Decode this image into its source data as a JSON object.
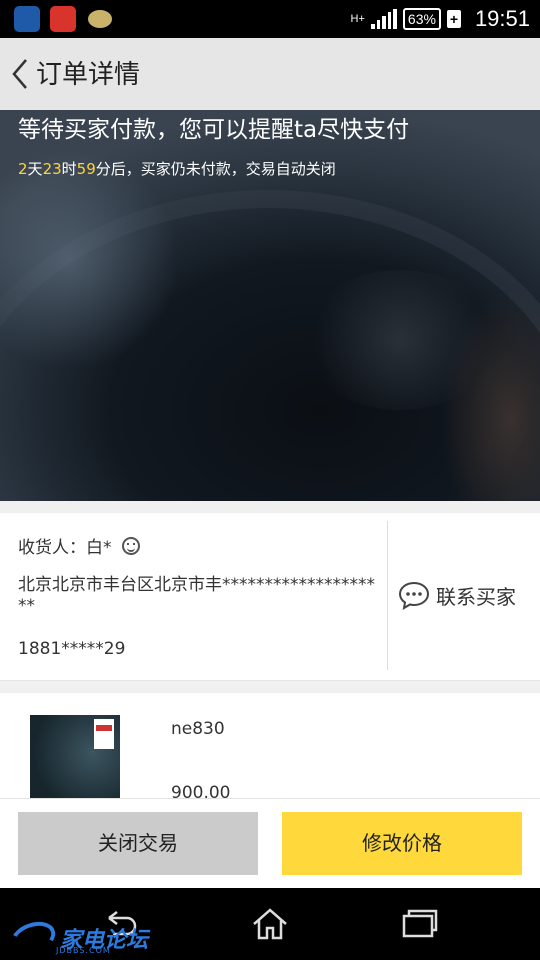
{
  "status_bar": {
    "network": "H+",
    "battery": "63%",
    "charging": "+",
    "time": "19:51"
  },
  "header": {
    "title": "订单详情"
  },
  "hero": {
    "title": "等待买家付款，您可以提醒ta尽快支付",
    "countdown": {
      "days": "2",
      "days_unit": "天",
      "hours": "23",
      "hours_unit": "时",
      "minutes": "59",
      "suffix": "分后，买家仍未付款，交易自动关闭"
    }
  },
  "address": {
    "recipient": "收货人：白*",
    "address": "北京北京市丰台区北京市丰********************",
    "phone": "1881*****29",
    "contact_label": "联系买家"
  },
  "product": {
    "name": "ne830",
    "price": "900.00"
  },
  "actions": {
    "close_label": "关闭交易",
    "edit_price_label": "修改价格"
  },
  "watermark": {
    "text": "家电论坛",
    "sub": "JDBBS.COM"
  },
  "colors": {
    "accent": "#ffd93b",
    "countdown_highlight": "#ffd23a"
  }
}
